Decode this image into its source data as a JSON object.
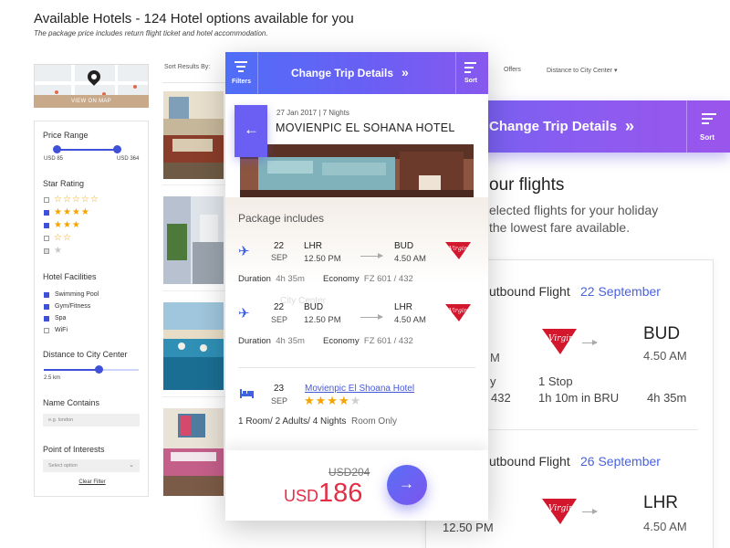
{
  "page": {
    "title": "Available Hotels - 124 Hotel options available for you",
    "subtitle": "The package price includes return flight ticket and hotel accommodation."
  },
  "map": {
    "button_label": "VIEW ON MAP"
  },
  "filters": {
    "price_range": {
      "label": "Price Range",
      "min_label": "USD 85",
      "max_label": "USD 364"
    },
    "star_rating": {
      "label": "Star Rating",
      "options": [
        {
          "stars": 5,
          "checked": false,
          "filled": false
        },
        {
          "stars": 4,
          "checked": true,
          "filled": true
        },
        {
          "stars": 3,
          "checked": true,
          "filled": true
        },
        {
          "stars": 2,
          "checked": false,
          "filled": false
        },
        {
          "stars": 1,
          "checked": false,
          "filled": false
        }
      ]
    },
    "facilities": {
      "label": "Hotel Facilities",
      "items": [
        {
          "label": "Swimming Pool",
          "checked": true
        },
        {
          "label": "Gym/Fitness",
          "checked": true
        },
        {
          "label": "Spa",
          "checked": true
        },
        {
          "label": "WiFi",
          "checked": false
        }
      ]
    },
    "distance": {
      "label": "Distance to City Center",
      "value_label": "2.5 km"
    },
    "name_contains": {
      "label": "Name Contains",
      "placeholder": "e.g. london"
    },
    "points_of_interest": {
      "label": "Point of Interests",
      "selected": "Select option"
    },
    "clear_label": "Clear Filter"
  },
  "sort": {
    "label": "Sort Results By:",
    "offers": "Offers",
    "distance": "Distance to City Center"
  },
  "mobile": {
    "header": {
      "filters_label": "Filters",
      "title": "Change Trip Details",
      "chevron": "»",
      "sort_label": "Sort"
    },
    "back_icon": "←",
    "trip_meta": "27 Jan 2017 | 7 Nights",
    "hotel_name": "MOVIENPIC EL SOHANA HOTEL",
    "package_title": "Package includes",
    "flights": [
      {
        "day": "22",
        "month": "SEP",
        "from_code": "LHR",
        "from_time": "12.50 PM",
        "to_code": "BUD",
        "to_time": "4.50 AM",
        "duration_label": "Duration",
        "duration": "4h 35m",
        "class_label": "Economy",
        "flight_no": "FZ 601 / 432"
      },
      {
        "day": "22",
        "month": "SEP",
        "from_code": "BUD",
        "from_time": "12.50 PM",
        "to_code": "LHR",
        "to_time": "4.50 AM",
        "duration_label": "Duration",
        "duration": "4h 35m",
        "class_label": "Economy",
        "flight_no": "FZ 601 / 432"
      }
    ],
    "hotel": {
      "day": "23",
      "month": "SEP",
      "link": "Movienpic El Shoana Hotel",
      "stars": 4,
      "max_stars": 5,
      "room_info": "1 Room/ 2 Adults/ 4 Nights",
      "board": "Room Only"
    },
    "price": {
      "old": "USD204",
      "currency": "USD",
      "amount": "186"
    },
    "go_icon": "→"
  },
  "right_panel": {
    "header_title": "Change Trip Details",
    "chevron": "»",
    "sort_label": "Sort",
    "heading": "our flights",
    "line1": "elected flights for your holiday",
    "line2": "the lowest fare available.",
    "outbound": {
      "title": "utbound Flight",
      "date": "22 September",
      "to_code": "BUD",
      "to_time": "4.50 AM",
      "stops": "1 Stop",
      "stop_detail": "1h 10m in BRU",
      "duration": "4h 35m",
      "left_m": "M",
      "left_y": "y",
      "left_num": "432"
    },
    "inbound": {
      "title": "utbound Flight",
      "date": "26 September",
      "to_code": "LHR",
      "from_time": "12.50 PM",
      "to_time": "4.50 AM"
    }
  },
  "colors": {
    "accent": "#4f6ef7",
    "accent2": "#8758ee",
    "price_red": "#e32e46",
    "star": "#f4a400",
    "link": "#4658da"
  }
}
